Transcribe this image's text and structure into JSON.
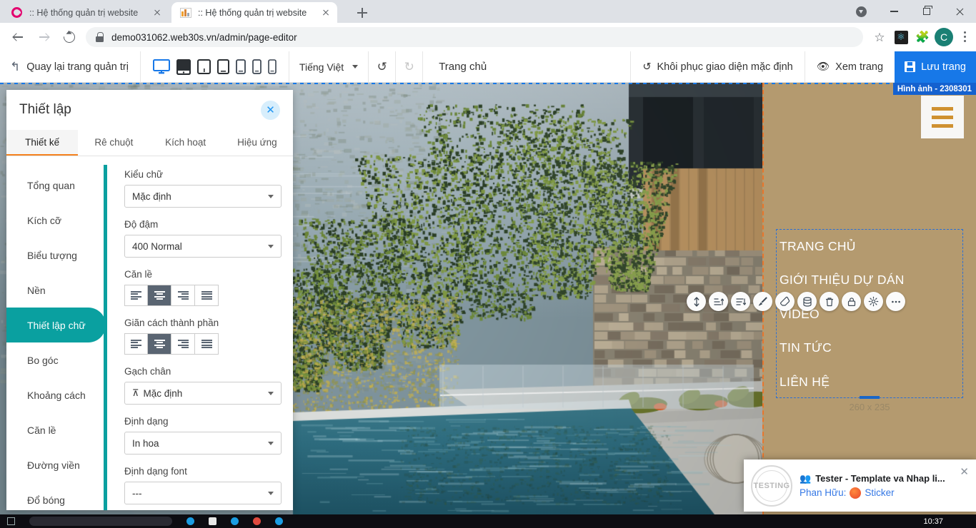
{
  "browser": {
    "tabs": [
      {
        "title": ":: Hệ thống quản trị website",
        "favicon": "rose-logo-icon",
        "active": false
      },
      {
        "title": ":: Hệ thống quản trị website",
        "favicon": "image-thumb-icon",
        "active": true
      }
    ],
    "new_tab_label": "+",
    "url_secure_prefix": "demo031062.web30s.vn",
    "url_path": "/admin/page-editor",
    "url_full": "demo031062.web30s.vn/admin/page-editor",
    "profile_initial": "C",
    "icons": {
      "back": "back-arrow-icon",
      "forward": "forward-arrow-icon",
      "reload": "reload-icon",
      "lock": "lock-icon",
      "bookmark": "star-icon",
      "react": "react-devtools-icon",
      "extensions": "puzzle-icon",
      "menu": "kebab-menu-icon",
      "download": "download-icon",
      "minimize": "minimize-icon",
      "maximize": "maximize-icon",
      "close": "close-icon"
    }
  },
  "appbar": {
    "back_label": "Quay lại trang quản trị",
    "devices": [
      {
        "name": "desktop",
        "active": true
      },
      {
        "name": "tablet-landscape",
        "active": false
      },
      {
        "name": "tablet",
        "active": false
      },
      {
        "name": "phablet",
        "active": false
      },
      {
        "name": "phone-large",
        "active": false
      },
      {
        "name": "phone",
        "active": false
      },
      {
        "name": "phone-small",
        "active": false
      }
    ],
    "language": "Tiếng Việt",
    "undo_enabled": true,
    "redo_enabled": false,
    "page_name": "Trang chủ",
    "restore_label": "Khôi phục giao diện mặc định",
    "preview_label": "Xem trang",
    "save_label": "Lưu trang"
  },
  "panel": {
    "title": "Thiết lập",
    "close_label": "✕",
    "tabs": [
      {
        "label": "Thiết kế",
        "active": true
      },
      {
        "label": "Rê chuột",
        "active": false
      },
      {
        "label": "Kích hoạt",
        "active": false
      },
      {
        "label": "Hiệu ứng",
        "active": false
      }
    ],
    "menu": [
      {
        "label": "Tổng quan",
        "active": false
      },
      {
        "label": "Kích cỡ",
        "active": false
      },
      {
        "label": "Biểu tượng",
        "active": false
      },
      {
        "label": "Nền",
        "active": false
      },
      {
        "label": "Thiết lập chữ",
        "active": true
      },
      {
        "label": "Bo góc",
        "active": false
      },
      {
        "label": "Khoảng cách",
        "active": false
      },
      {
        "label": "Căn lề",
        "active": false
      },
      {
        "label": "Đường viền",
        "active": false
      },
      {
        "label": "Đổ bóng",
        "active": false
      }
    ],
    "fields": {
      "font_family_label": "Kiểu chữ",
      "font_family_value": "Mặc định",
      "font_weight_label": "Độ đậm",
      "font_weight_value": "400 Normal",
      "align_label": "Căn lề",
      "align_selected_index": 1,
      "align_options": [
        "left",
        "center",
        "right",
        "justify"
      ],
      "spacing_label": "Giãn cách thành phần",
      "spacing_selected_index": 1,
      "spacing_options": [
        "left",
        "center",
        "right",
        "justify"
      ],
      "underline_label": "Gạch chân",
      "underline_value": "Mặc định",
      "transform_label": "Định dạng",
      "transform_value": "In hoa",
      "font_style_label": "Định dạng font",
      "font_style_value": "---"
    }
  },
  "canvas": {
    "image_tag": "Hình ảnh - 2308301",
    "float_tools": [
      "move-vertical-icon",
      "sort-ascending-icon",
      "sort-descending-icon",
      "brush-icon",
      "eraser-icon",
      "layers-icon",
      "trash-icon",
      "lock-icon",
      "gear-icon",
      "more-icon"
    ],
    "hamburger": "hamburger-menu-icon",
    "nav_items": [
      "TRANG CHỦ",
      "GIỚI THIỆU DỰ DÁN",
      "VIDEO",
      "TIN TỨC",
      "LIÊN HỆ"
    ],
    "size_hint": "260 x 235",
    "tan_color": "#b49a6f",
    "accent_color": "#0aa0a0",
    "save_color": "#1778e8",
    "tab_accent_color": "#f5821f"
  },
  "chat_popup": {
    "stamp_top": "BETA",
    "stamp_mid": "TESTING",
    "stamp_bottom": "BETA",
    "title": "Tester - Template va Nhap li...",
    "sender": "Phan Hữu:",
    "message": "Sticker",
    "close_label": "✕",
    "group_icon": "people-icon",
    "emoji": "angry-emoji"
  },
  "taskbar": {
    "clock": "10:37"
  }
}
